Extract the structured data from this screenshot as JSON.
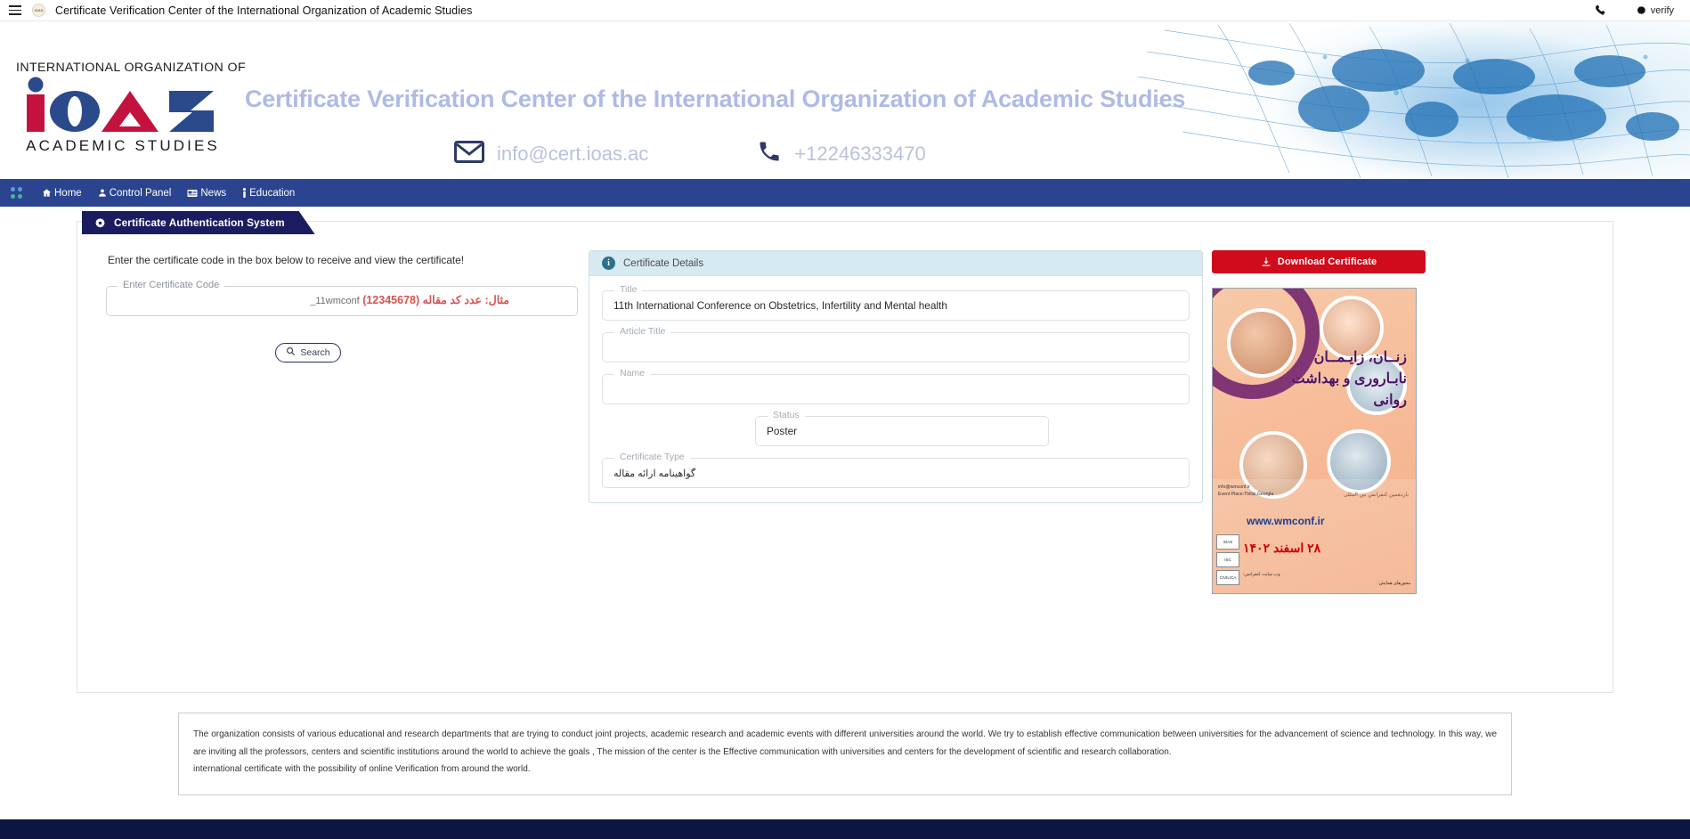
{
  "browser": {
    "menu_icon": "hamburger-icon",
    "favicon": "ioas-favicon",
    "tab_title": "Certificate Verification Center of the International Organization of Academic Studies",
    "right_items": [
      {
        "icon": "phone-icon",
        "label": ""
      },
      {
        "icon": "burst-icon",
        "label": "verify"
      }
    ]
  },
  "header": {
    "logo": {
      "top_line": "INTERNATIONAL ORGANIZATION OF",
      "mark": "iOAS",
      "bottom_line": "ACADEMIC STUDIES",
      "colors": {
        "red": "#c4123f",
        "blue": "#2b4a8b"
      }
    },
    "title": "Certificate Verification Center of the International Organization of Academic Studies",
    "title_color": "#aebae6",
    "email": "info@cert.ioas.ac",
    "email_icon": "envelope-icon",
    "phone": "+12246333470",
    "phone_icon": "phone-icon"
  },
  "nav": {
    "grid_icon": "grid-dots-icon",
    "items": [
      {
        "label": "Home",
        "icon": "home-icon"
      },
      {
        "label": "Control Panel",
        "icon": "user-icon"
      },
      {
        "label": "News",
        "icon": "newspaper-icon"
      },
      {
        "label": "Education",
        "icon": "info-icon"
      }
    ],
    "bg_color": "#2b4490"
  },
  "card": {
    "ribbon_title": "Certificate Authentication System",
    "ribbon_icon": "gear-icon",
    "ribbon_color": "#1b1c60"
  },
  "search_panel": {
    "lead": "Enter the certificate code in the box below to receive and view the certificate!",
    "field_legend": "Enter Certificate Code",
    "field_value": "",
    "field_placeholder_fa": "مثال: عدد کد مقاله (12345678)",
    "field_placeholder_code": "11wmconf_",
    "search_button": "Search",
    "search_icon": "search-icon"
  },
  "details": {
    "header_title": "Certificate Details",
    "header_icon": "info-icon",
    "fields": [
      {
        "legend": "Title",
        "value": "11th International Conference on Obstetrics, Infertility and Mental health"
      },
      {
        "legend": "Article Title",
        "value": ""
      },
      {
        "legend": "Name",
        "value": ""
      },
      {
        "legend": "Status",
        "value": "Poster"
      },
      {
        "legend": "Certificate Type",
        "value": "گواهینامه ارائه مقاله"
      }
    ]
  },
  "sidebar": {
    "download_button": "Download Certificate",
    "download_icon": "download-icon",
    "download_color": "#cf0b1c",
    "poster": {
      "title_fa": "زنــان، زایـمــان نابـاروری و بهداشت روانی",
      "subtitle_fa": "یازدهمین کنفرانس بین المللی",
      "email": "info@wmconf.ir",
      "event_place": "Event Place:Tbilisi,Georgia",
      "website_label": "وب سایت کنفرانس:",
      "website": "www.wmconf.ir",
      "red_line": "۲۸ اسفند ۱۴۰۲",
      "topics_heading": "محورهای همایش:",
      "badges": [
        "iOAS",
        "ISC",
        "CIVILICA"
      ]
    }
  },
  "footer": {
    "paragraph1": "The organization consists of various educational and research departments that are trying to conduct joint projects, academic research and academic events with different universities around the world. We try to establish effective communication between universities for the advancement of science and technology. In this way, we are inviting all the professors, centers and scientific institutions around the world to achieve the goals , The mission of the center is the Effective communication with universities and centers for the development of scientific and research collaboration.",
    "paragraph2": "international certificate with the possibility of online Verification from around the world."
  }
}
